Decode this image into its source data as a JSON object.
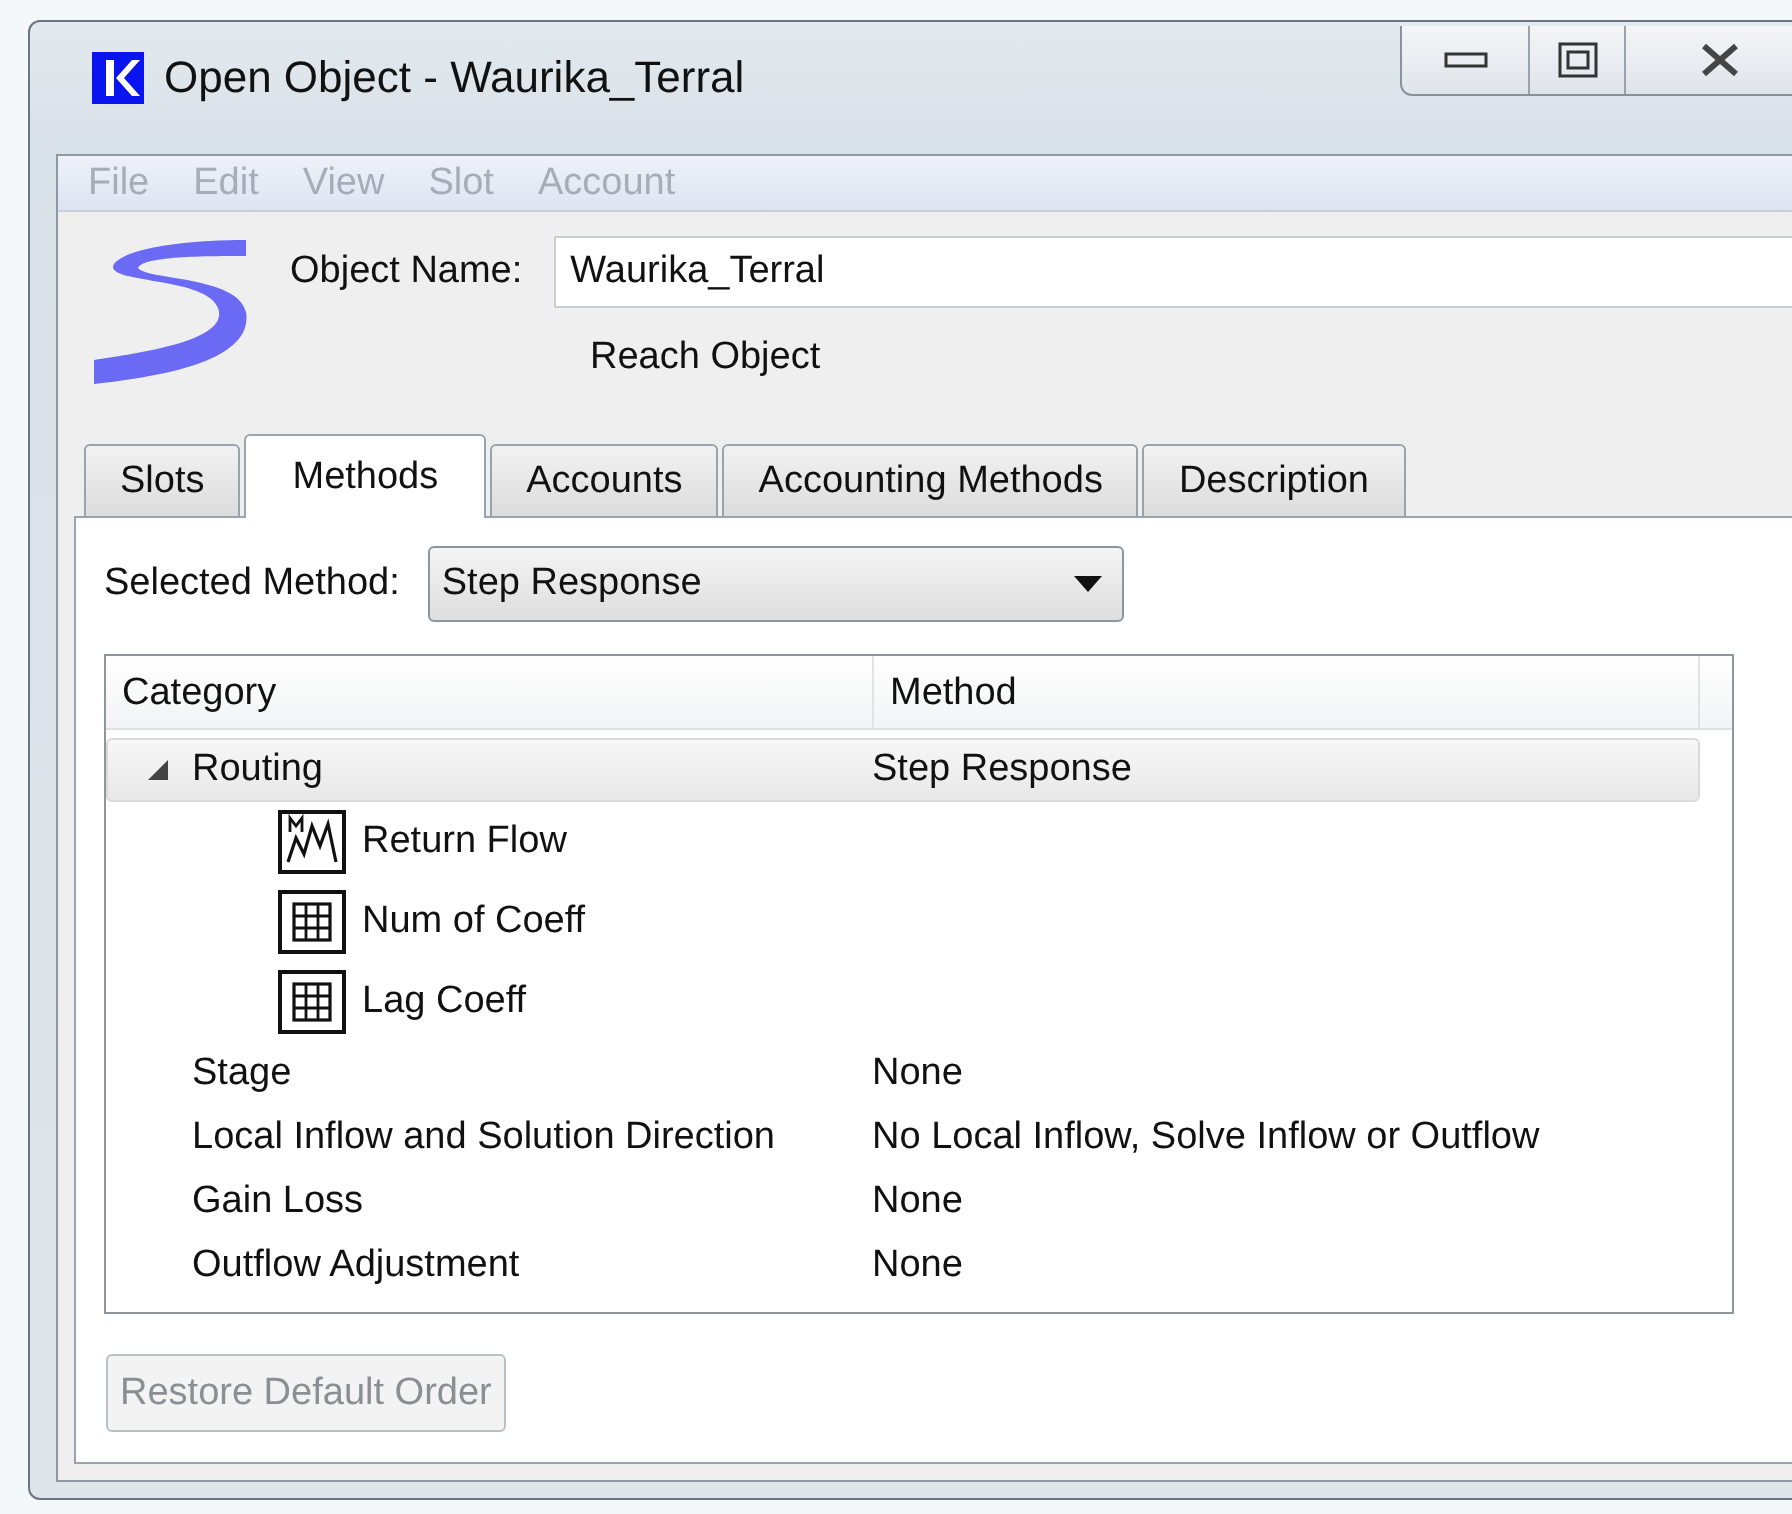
{
  "window": {
    "title": "Open Object - Waurika_Terral"
  },
  "menu": [
    {
      "label": "File",
      "disabled": true
    },
    {
      "label": "Edit",
      "disabled": true
    },
    {
      "label": "View",
      "disabled": true
    },
    {
      "label": "Slot",
      "disabled": true
    },
    {
      "label": "Account",
      "disabled": true
    }
  ],
  "object": {
    "name_label": "Object Name:",
    "name": "Waurika_Terral",
    "type": "Reach Object"
  },
  "tabs": [
    {
      "label": "Slots",
      "selected": false
    },
    {
      "label": "Methods",
      "selected": true
    },
    {
      "label": "Accounts",
      "selected": false
    },
    {
      "label": "Accounting Methods",
      "selected": false
    },
    {
      "label": "Description",
      "selected": false
    }
  ],
  "selected_method": {
    "label": "Selected Method:",
    "value": "Step Response"
  },
  "tree": {
    "columns": [
      "Category",
      "Method"
    ],
    "rows": [
      {
        "category": "Routing",
        "method": "Step Response",
        "expanded": true,
        "selected": true,
        "children": [
          {
            "label": "Return Flow",
            "kind": "series"
          },
          {
            "label": "Num of Coeff",
            "kind": "table"
          },
          {
            "label": "Lag Coeff",
            "kind": "table"
          }
        ]
      },
      {
        "category": "Stage",
        "method": "None",
        "selected": false
      },
      {
        "category": "Local Inflow and Solution Direction",
        "method": "No Local Inflow, Solve Inflow or Outflow",
        "selected": false
      },
      {
        "category": "Gain Loss",
        "method": "None",
        "selected": false
      },
      {
        "category": "Outflow Adjustment",
        "method": "None",
        "selected": false
      }
    ]
  },
  "restore_button": {
    "label": "Restore Default Order",
    "disabled": true
  }
}
